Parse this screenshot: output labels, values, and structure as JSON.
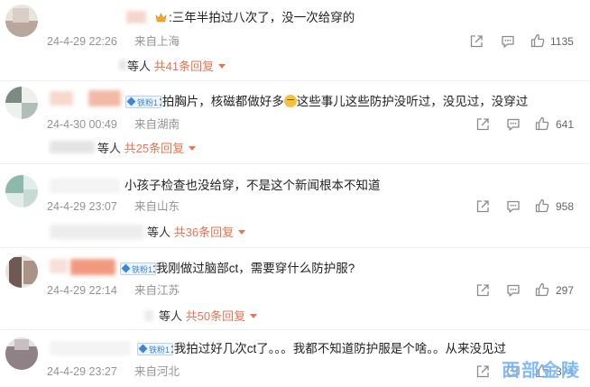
{
  "comments": [
    {
      "text": ":三年半拍过八次了，没一次给穿的",
      "date": "24-4-29 22:26",
      "location": "来自上海",
      "likes": "1135",
      "reply_who": "等人",
      "reply_count": "共41条回复"
    },
    {
      "badge": "铁粉1",
      "text_before": ":拍胸片，核磁都做好多",
      "text_after": "这些事儿这些防护没听过，没见过，没穿过",
      "date": "24-4-30 00:49",
      "location": "来自湖南",
      "likes": "641",
      "reply_who": "等人",
      "reply_count": "共25条回复"
    },
    {
      "text": "小孩子检查也没给穿，不是这个新闻根本不知道",
      "date": "24-4-29 23:07",
      "location": "来自山东",
      "likes": "958",
      "reply_who": "等人",
      "reply_count": "共36条回复"
    },
    {
      "badge": "铁粉1",
      "text": ":我刚做过脑部ct，需要穿什么防护服?",
      "date": "24-4-29 22:14",
      "location": "来自江苏",
      "likes": "297",
      "reply_who": "等人",
      "reply_count": "共50条回复"
    },
    {
      "badge": "铁粉1",
      "text": ":我拍过好几次ct了。。。我都不知道防护服是个啥。。从来没见过",
      "date": "24-4-29 23:27",
      "location": "来自河北",
      "likes": "374"
    }
  ],
  "watermark": "西部金陵",
  "icons": {
    "share": "share-icon",
    "comment": "comment-icon",
    "like": "thumbs-up-icon"
  }
}
